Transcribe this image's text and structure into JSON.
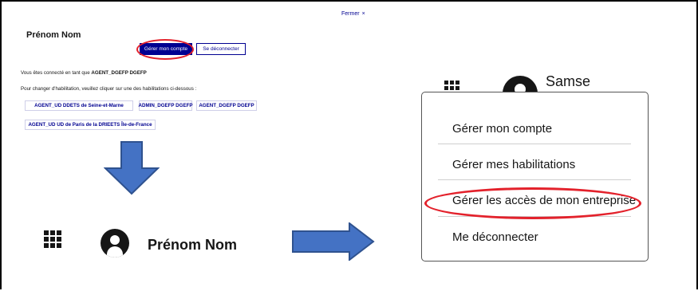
{
  "top_panel": {
    "close_label": "Fermer",
    "close_icon": "×",
    "user_name": "Prénom Nom",
    "manage_account_label": "Gérer mon compte",
    "logout_label": "Se déconnecter",
    "connected_prefix": "Vous êtes connecté en tant que ",
    "connected_as": "AGENT_DGEFP DGEFP",
    "change_text": "Pour changer d'habilitation, veuillez cliquer sur une des habilitations ci-dessous :",
    "habilitations": [
      "AGENT_UD DDETS de Seine-et-Marne",
      "ADMIN_DGEFP DGEFP",
      "AGENT_DGEFP DGEFP",
      "AGENT_UD UD de Paris de la DRIEETS Île-de-France"
    ]
  },
  "bottom_header": {
    "user_name": "Prénom Nom",
    "apps_icon": "waffle-grid-icon",
    "avatar_icon": "user-avatar-icon"
  },
  "right_panel": {
    "user_name": "Samse",
    "menu_items": [
      "Gérer mon compte",
      "Gérer mes habilitations",
      "Gérer les accès de mon entreprise",
      "Me déconnecter"
    ]
  },
  "colors": {
    "primary": "#000091",
    "highlight": "#e3212b",
    "arrow_fill": "#4472c4",
    "arrow_stroke": "#2f528f"
  }
}
